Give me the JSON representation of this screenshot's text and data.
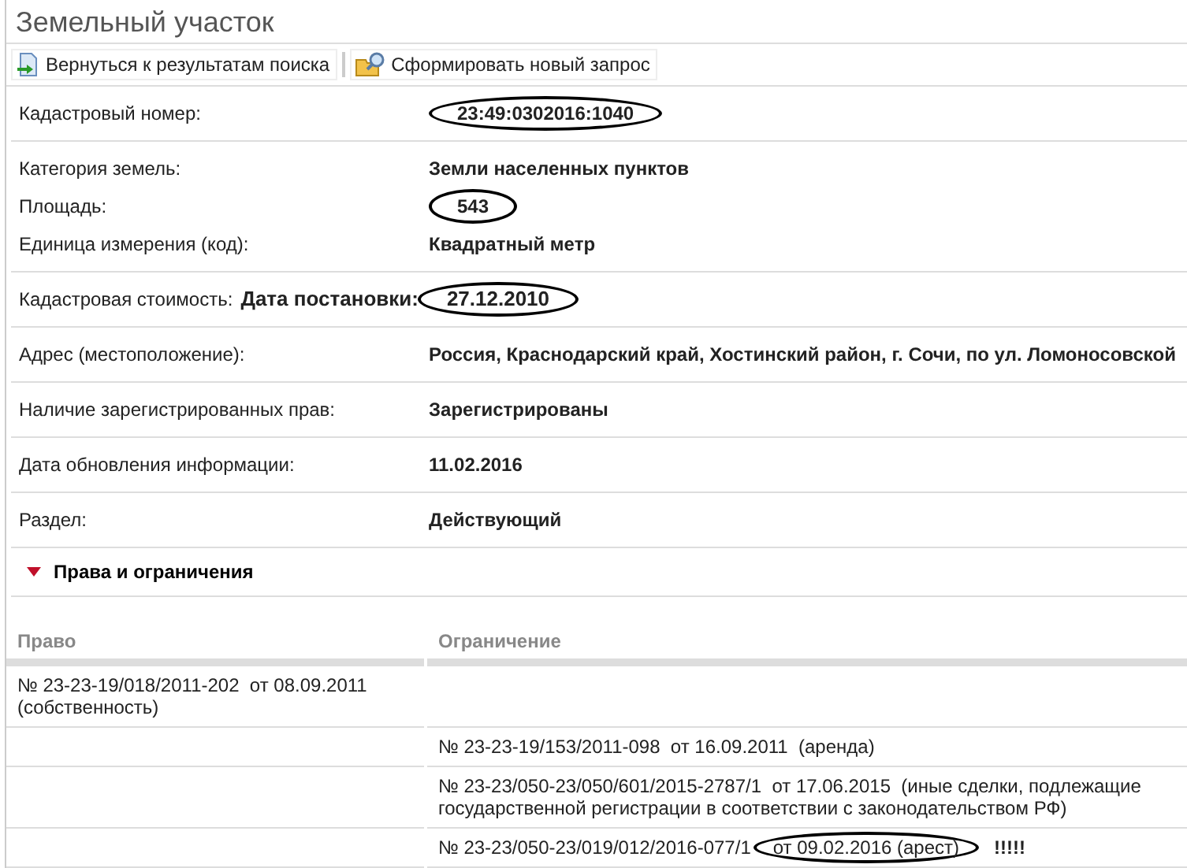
{
  "title": "Земельный участок",
  "toolbar": [
    {
      "label": "Вернуться к результатам поиска"
    },
    {
      "label": "Сформировать новый запрос"
    }
  ],
  "field_groups": [
    [
      {
        "kind": "plain",
        "label": "Кадастровый номер:",
        "value": "23:49:0302016:1040",
        "circled": true
      }
    ],
    [
      {
        "kind": "plain",
        "label": "Категория земель:",
        "value": "Земли населенных пунктов",
        "circled": false
      },
      {
        "kind": "plain",
        "label": "Площадь:",
        "value": "543",
        "circled": true
      },
      {
        "kind": "plain",
        "label": "Единица измерения (код):",
        "value": "Квадратный метр",
        "circled": false
      }
    ],
    [
      {
        "kind": "inline",
        "label": "Кадастровая стоимость:",
        "sublabel": "Дата постановки:",
        "value": "27.12.2010",
        "circled": true
      }
    ],
    [
      {
        "kind": "plain",
        "label": "Адрес (местоположение):",
        "value": "Россия, Краснодарский край, Хостинский район, г. Сочи, по ул. Ломоносовской",
        "circled": false
      }
    ],
    [
      {
        "kind": "plain",
        "label": "Наличие зарегистрированных прав:",
        "value": "Зарегистрированы",
        "circled": false
      }
    ],
    [
      {
        "kind": "plain",
        "label": "Дата обновления информации:",
        "value": "11.02.2016",
        "circled": false
      }
    ],
    [
      {
        "kind": "plain",
        "label": "Раздел:",
        "value": "Действующий",
        "circled": false
      }
    ]
  ],
  "section": {
    "title": "Права и ограничения",
    "expanded": true
  },
  "table": {
    "columns": [
      "Право",
      "Ограничение"
    ],
    "rows": [
      {
        "right": "№ 23-23-19/018/2011-202  от 08.09.2011  (собственность)",
        "restriction": []
      },
      {
        "restriction": [
          {
            "text": "№ 23-23-19/153/2011-098  от 16.09.2011  (аренда)",
            "circled": false
          }
        ]
      },
      {
        "restriction": [
          {
            "text": "№ 23-23/050-23/050/601/2015-2787/1  от 17.06.2015  (иные сделки, подлежащие государственной регистрации в соответствии с законодательством РФ)",
            "circled": false
          }
        ]
      },
      {
        "restriction": [
          {
            "text": "№ 23-23/050-23/019/012/2016-077/1",
            "circled": false
          },
          {
            "text": "от 09.02.2016  (арест)",
            "circled": true
          }
        ],
        "note": "!!!!!"
      }
    ]
  }
}
